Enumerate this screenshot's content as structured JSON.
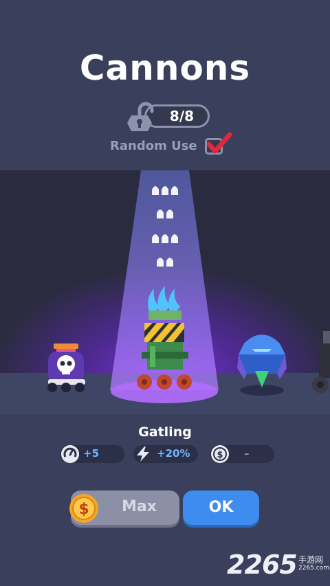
{
  "header": {
    "title": "Cannons"
  },
  "unlock": {
    "count": "8/8",
    "icon": "unlocked-padlock-icon"
  },
  "random_use": {
    "label": "Random Use",
    "checked": true
  },
  "stage": {
    "selected": "Gatling",
    "cannons": [
      "skull-cannon",
      "gatling-cannon",
      "crystal-cannon",
      "dark-cannon"
    ],
    "bullet_rows": [
      3,
      2,
      3,
      2
    ]
  },
  "stats": {
    "title": "Gatling",
    "speed": {
      "icon": "speedometer-icon",
      "value": "+5"
    },
    "power": {
      "icon": "lightning-icon",
      "value": "+20%"
    },
    "cost": {
      "icon": "dollar-coin-icon",
      "value": "–"
    }
  },
  "buttons": {
    "max_label": "Max",
    "ok_label": "OK"
  },
  "watermark": {
    "main": "2265",
    "sub": "手游网",
    "url": "2265.com"
  },
  "colors": {
    "accent_blue": "#3f8cf0",
    "check_red": "#e0283a",
    "background": "#3a3f5c"
  }
}
